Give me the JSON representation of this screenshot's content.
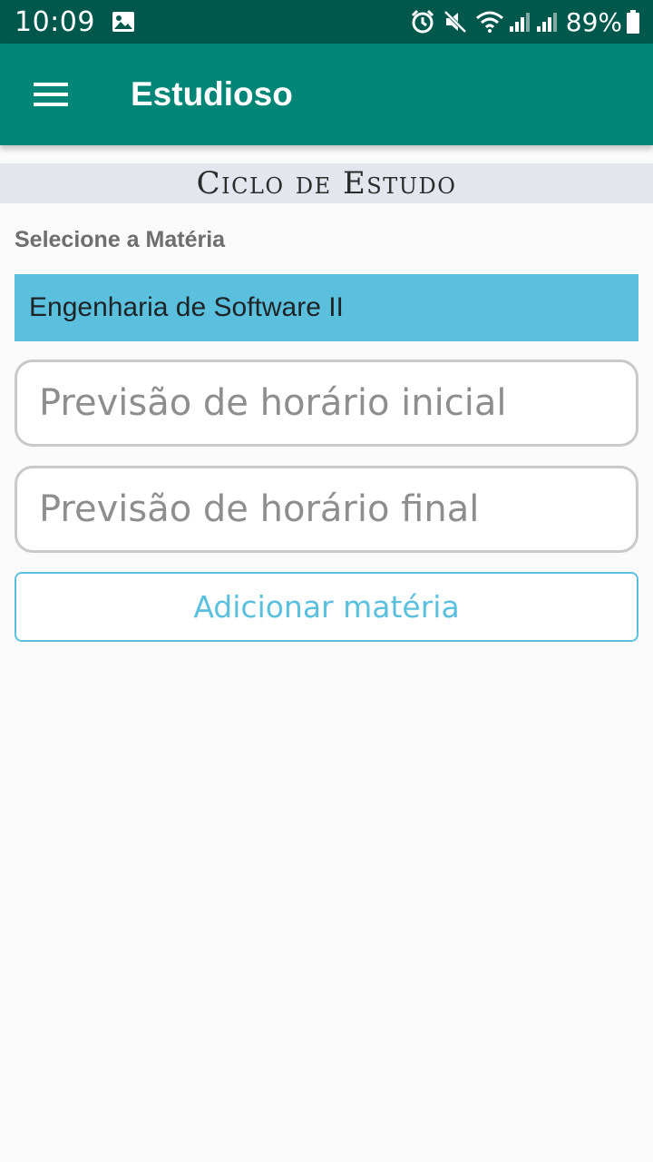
{
  "status_bar": {
    "time": "10:09",
    "battery": "89%",
    "icons": [
      "image-icon",
      "alarm-icon",
      "mute-icon",
      "wifi-icon",
      "signal-icon",
      "signal-icon",
      "battery-icon"
    ]
  },
  "app_bar": {
    "title": "Estudioso",
    "menu_icon": "hamburger-menu-icon",
    "background": "#008577"
  },
  "section": {
    "title": "Ciclo de Estudo"
  },
  "form": {
    "subject_label": "Selecione a Matéria",
    "selected_subject": "Engenharia de Software II",
    "start_time_placeholder": "Previsão de horário inicial",
    "end_time_placeholder": "Previsão de horário final",
    "add_button_label": "Adicionar matéria",
    "accent_color": "#5bc0de"
  }
}
